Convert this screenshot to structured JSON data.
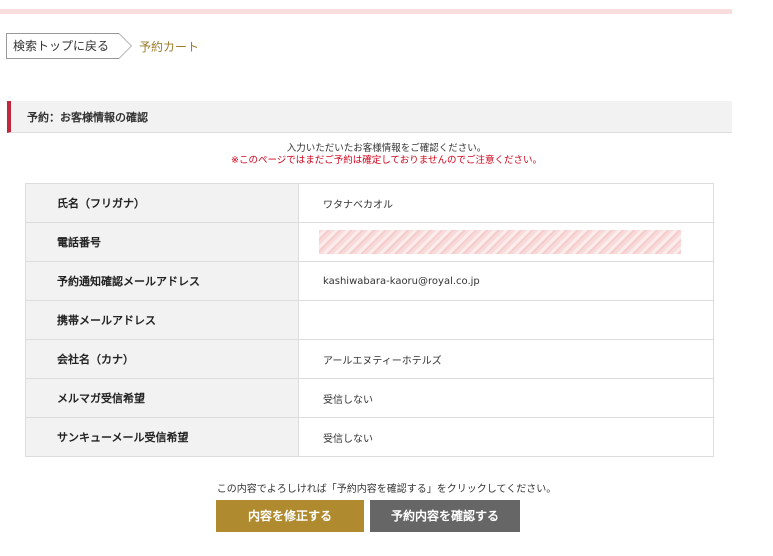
{
  "breadcrumb": {
    "back_label": "検索トップに戻る",
    "current_label": "予約カート"
  },
  "section": {
    "title": "予約：お客様情報の確認"
  },
  "notice": {
    "line1": "入力いただいたお客様情報をご確認ください。",
    "line2": "※このページではまだご予約は確定しておりませんのでご注意ください。"
  },
  "rows": [
    {
      "label": "氏名（フリガナ）",
      "value": "ワタナベカオル"
    },
    {
      "label": "電話番号",
      "value": ""
    },
    {
      "label": "予約通知確認メールアドレス",
      "value": "kashiwabara-kaoru@royal.co.jp"
    },
    {
      "label": "携帯メールアドレス",
      "value": ""
    },
    {
      "label": "会社名（カナ）",
      "value": "アールエヌティーホテルズ"
    },
    {
      "label": "メルマガ受信希望",
      "value": "受信しない"
    },
    {
      "label": "サンキューメール受信希望",
      "value": "受信しない"
    }
  ],
  "confirm_text": "この内容でよろしければ「予約内容を確認する」をクリックしてください。",
  "buttons": {
    "edit_label": "内容を修正する",
    "confirm_label": "予約内容を確認する"
  },
  "colors": {
    "accent_red": "#c0283b",
    "gold_button": "#b08a2e",
    "gray_button": "#666666",
    "warning_text": "#d0021b"
  }
}
